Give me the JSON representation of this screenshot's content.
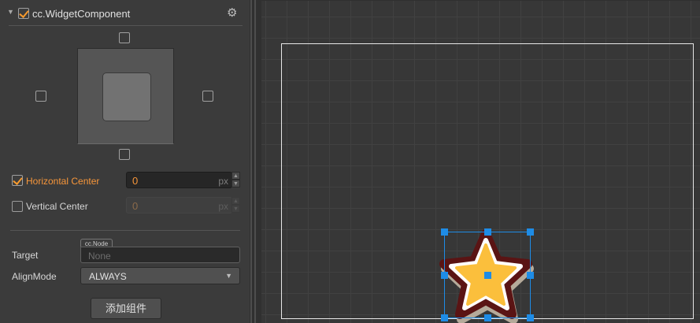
{
  "inspector": {
    "component_title": "cc.WidgetComponent",
    "component_enabled": true,
    "horizontal_center": {
      "label": "Horizontal Center",
      "checked": true,
      "value": "0",
      "unit": "px"
    },
    "vertical_center": {
      "label": "Vertical Center",
      "checked": false,
      "value": "0",
      "unit": "px"
    },
    "target": {
      "label": "Target",
      "type_tag": "cc.Node",
      "value": "None"
    },
    "align_mode": {
      "label": "AlignMode",
      "value": "ALWAYS"
    },
    "add_component_label": "添加组件",
    "icons": {
      "fold": "triangle-down",
      "settings": "gear-icon",
      "stepper": "spin-arrows",
      "dropdown": "chevron-down"
    }
  },
  "scene": {
    "selected_node": "star-sprite",
    "colors": {
      "selection": "#1e8ce6",
      "star_fill": "#fbbf3c",
      "star_outline": "#5a1414",
      "design_border": "#e8e8e8"
    }
  },
  "colors": {
    "accent": "#f7963a",
    "panel_bg": "#3b3b3b",
    "scene_bg": "#373737"
  }
}
